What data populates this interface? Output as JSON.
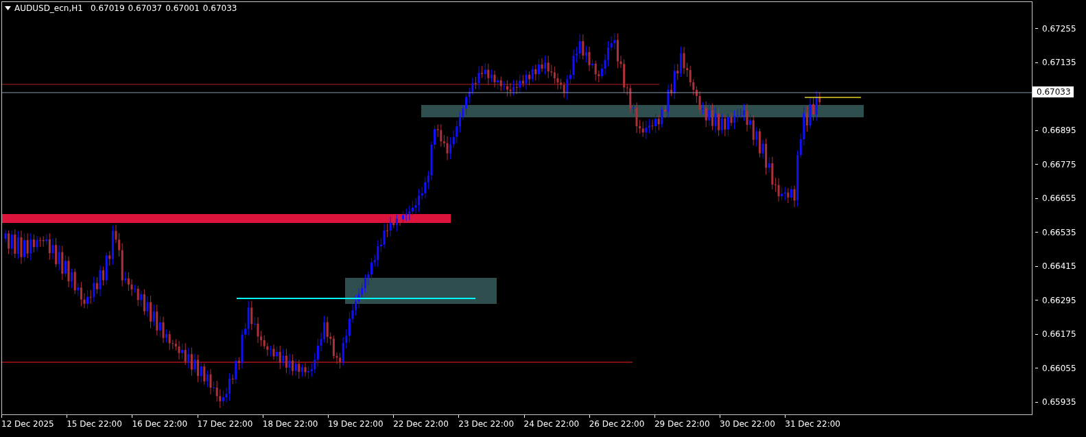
{
  "header": {
    "symbol": "AUDUSD_ecn,H1",
    "open": "0.67019",
    "high": "0.67037",
    "low": "0.67001",
    "close": "0.67033"
  },
  "price_axis": [
    "0.67255",
    "0.67135",
    "0.66895",
    "0.66775",
    "0.66655",
    "0.66535",
    "0.66415",
    "0.66295",
    "0.66175",
    "0.66055",
    "0.65935"
  ],
  "current_price": "0.67033",
  "time_axis": [
    "12 Dec 2025",
    "15 Dec 22:00",
    "16 Dec 22:00",
    "17 Dec 22:00",
    "18 Dec 22:00",
    "19 Dec 22:00",
    "22 Dec 22:00",
    "23 Dec 22:00",
    "24 Dec 22:00",
    "26 Dec 22:00",
    "29 Dec 22:00",
    "30 Dec 22:00",
    "31 Dec 22:00"
  ]
}
